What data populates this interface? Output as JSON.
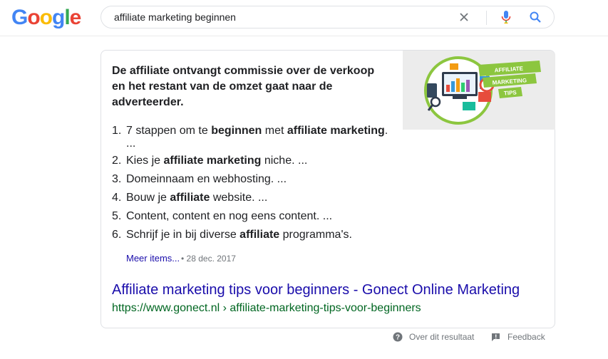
{
  "header": {
    "logo": [
      "G",
      "o",
      "o",
      "g",
      "l",
      "e"
    ],
    "search_value": "affiliate marketing beginnen"
  },
  "snippet": {
    "answer": "De affiliate ontvangt commissie over de verkoop en het restant van de omzet gaat naar de adverteerder.",
    "image_labels": [
      "AFFILIATE",
      "MARKETING",
      "TIPS"
    ],
    "steps": [
      {
        "num": "1.",
        "parts": [
          {
            "t": "7 stappen om te ",
            "b": false
          },
          {
            "t": "beginnen",
            "b": true
          },
          {
            "t": " met ",
            "b": false
          },
          {
            "t": "affiliate marketing",
            "b": true
          },
          {
            "t": ".",
            "b": false
          }
        ],
        "continuation": "..."
      },
      {
        "num": "2.",
        "parts": [
          {
            "t": "Kies je ",
            "b": false
          },
          {
            "t": "affiliate marketing",
            "b": true
          },
          {
            "t": " niche. ...",
            "b": false
          }
        ]
      },
      {
        "num": "3.",
        "parts": [
          {
            "t": "Domeinnaam en webhosting. ...",
            "b": false
          }
        ]
      },
      {
        "num": "4.",
        "parts": [
          {
            "t": "Bouw je ",
            "b": false
          },
          {
            "t": "affiliate",
            "b": true
          },
          {
            "t": " website. ...",
            "b": false
          }
        ]
      },
      {
        "num": "5.",
        "parts": [
          {
            "t": "Content, content en nog eens content. ...",
            "b": false
          }
        ]
      },
      {
        "num": "6.",
        "parts": [
          {
            "t": "Schrijf je in bij diverse ",
            "b": false
          },
          {
            "t": "affiliate",
            "b": true
          },
          {
            "t": " programma's.",
            "b": false
          }
        ]
      }
    ],
    "more_items": "Meer items...",
    "date": "• 28 dec. 2017",
    "result_title": "Affiliate marketing tips voor beginners - Gonect Online Marketing",
    "result_url": "https://www.gonect.nl › affiliate-marketing-tips-voor-beginners"
  },
  "footer": {
    "about": "Over dit resultaat",
    "feedback": "Feedback"
  },
  "colors": {
    "link": "#1a0dab",
    "url": "#006621",
    "g_blue": "#4285f4",
    "g_red": "#ea4335",
    "g_yellow": "#fbbc05",
    "g_green": "#34a853"
  }
}
